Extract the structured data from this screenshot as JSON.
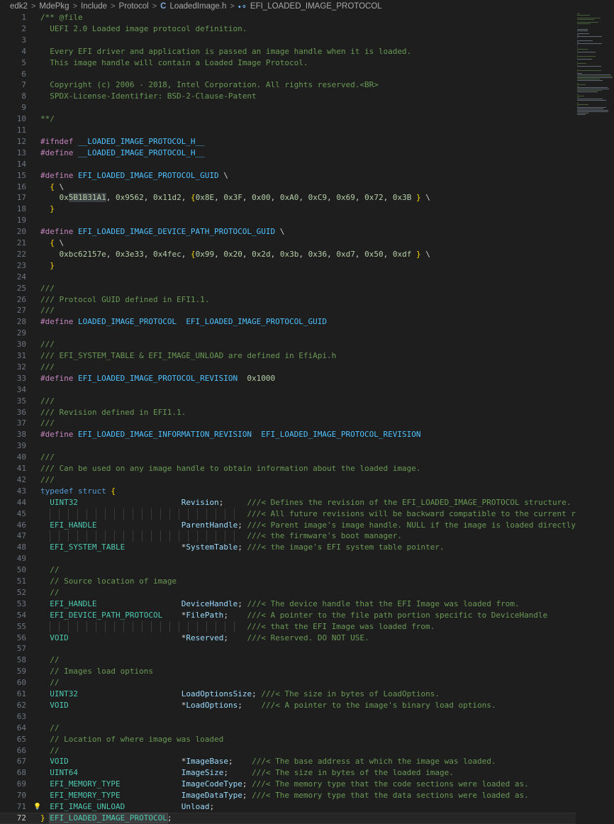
{
  "breadcrumb": {
    "items": [
      "edk2",
      "MdePkg",
      "Include",
      "Protocol"
    ],
    "file_name": "LoadedImage.h",
    "symbol": "EFI_LOADED_IMAGE_PROTOCOL",
    "separator": ">"
  },
  "editor": {
    "current_line": 72,
    "lines": [
      {
        "n": "1",
        "t": "/** @file"
      },
      {
        "n": "2",
        "t": "  UEFI 2.0 Loaded image protocol definition."
      },
      {
        "n": "3",
        "t": ""
      },
      {
        "n": "4",
        "t": "  Every EFI driver and application is passed an image handle when it is loaded."
      },
      {
        "n": "5",
        "t": "  This image handle will contain a Loaded Image Protocol."
      },
      {
        "n": "6",
        "t": ""
      },
      {
        "n": "7",
        "t": "  Copyright (c) 2006 - 2018, Intel Corporation. All rights reserved.<BR>"
      },
      {
        "n": "8",
        "t": "  SPDX-License-Identifier: BSD-2-Clause-Patent"
      },
      {
        "n": "9",
        "t": ""
      },
      {
        "n": "10",
        "t": "**/"
      },
      {
        "n": "11",
        "t": ""
      },
      {
        "n": "12",
        "t": "#ifndef __LOADED_IMAGE_PROTOCOL_H__"
      },
      {
        "n": "13",
        "t": "#define __LOADED_IMAGE_PROTOCOL_H__"
      },
      {
        "n": "14",
        "t": ""
      },
      {
        "n": "15",
        "t": "#define EFI_LOADED_IMAGE_PROTOCOL_GUID \\"
      },
      {
        "n": "16",
        "t": "  { \\"
      },
      {
        "n": "17",
        "t": "    0x5B1B31A1, 0x9562, 0x11d2, {0x8E, 0x3F, 0x00, 0xA0, 0xC9, 0x69, 0x72, 0x3B } \\"
      },
      {
        "n": "18",
        "t": "  }"
      },
      {
        "n": "19",
        "t": ""
      },
      {
        "n": "20",
        "t": "#define EFI_LOADED_IMAGE_DEVICE_PATH_PROTOCOL_GUID \\"
      },
      {
        "n": "21",
        "t": "  { \\"
      },
      {
        "n": "22",
        "t": "    0xbc62157e, 0x3e33, 0x4fec, {0x99, 0x20, 0x2d, 0x3b, 0x36, 0xd7, 0x50, 0xdf } \\"
      },
      {
        "n": "23",
        "t": "  }"
      },
      {
        "n": "24",
        "t": ""
      },
      {
        "n": "25",
        "t": "///"
      },
      {
        "n": "26",
        "t": "/// Protocol GUID defined in EFI1.1."
      },
      {
        "n": "27",
        "t": "///"
      },
      {
        "n": "28",
        "t": "#define LOADED_IMAGE_PROTOCOL  EFI_LOADED_IMAGE_PROTOCOL_GUID"
      },
      {
        "n": "29",
        "t": ""
      },
      {
        "n": "30",
        "t": "///"
      },
      {
        "n": "31",
        "t": "/// EFI_SYSTEM_TABLE & EFI_IMAGE_UNLOAD are defined in EfiApi.h"
      },
      {
        "n": "32",
        "t": "///"
      },
      {
        "n": "33",
        "t": "#define EFI_LOADED_IMAGE_PROTOCOL_REVISION  0x1000"
      },
      {
        "n": "34",
        "t": ""
      },
      {
        "n": "35",
        "t": "///"
      },
      {
        "n": "36",
        "t": "/// Revision defined in EFI1.1."
      },
      {
        "n": "37",
        "t": "///"
      },
      {
        "n": "38",
        "t": "#define EFI_LOADED_IMAGE_INFORMATION_REVISION  EFI_LOADED_IMAGE_PROTOCOL_REVISION"
      },
      {
        "n": "39",
        "t": ""
      },
      {
        "n": "40",
        "t": "///"
      },
      {
        "n": "41",
        "t": "/// Can be used on any image handle to obtain information about the loaded image."
      },
      {
        "n": "42",
        "t": "///"
      },
      {
        "n": "43",
        "t": "typedef struct {"
      },
      {
        "n": "44",
        "t": "  UINT32                      Revision;     ///< Defines the revision of the EFI_LOADED_IMAGE_PROTOCOL structure."
      },
      {
        "n": "45",
        "t": "                                            ///< All future revisions will be backward compatible to the current revis"
      },
      {
        "n": "46",
        "t": "  EFI_HANDLE                  ParentHandle; ///< Parent image's image handle. NULL if the image is loaded directly fro"
      },
      {
        "n": "47",
        "t": "                                            ///< the firmware's boot manager."
      },
      {
        "n": "48",
        "t": "  EFI_SYSTEM_TABLE            *SystemTable; ///< the image's EFI system table pointer."
      },
      {
        "n": "49",
        "t": ""
      },
      {
        "n": "50",
        "t": "  //"
      },
      {
        "n": "51",
        "t": "  // Source location of image"
      },
      {
        "n": "52",
        "t": "  //"
      },
      {
        "n": "53",
        "t": "  EFI_HANDLE                  DeviceHandle; ///< The device handle that the EFI Image was loaded from."
      },
      {
        "n": "54",
        "t": "  EFI_DEVICE_PATH_PROTOCOL    *FilePath;    ///< A pointer to the file path portion specific to DeviceHandle"
      },
      {
        "n": "55",
        "t": "                                            ///< that the EFI Image was loaded from."
      },
      {
        "n": "56",
        "t": "  VOID                        *Reserved;    ///< Reserved. DO NOT USE."
      },
      {
        "n": "57",
        "t": ""
      },
      {
        "n": "58",
        "t": "  //"
      },
      {
        "n": "59",
        "t": "  // Images load options"
      },
      {
        "n": "60",
        "t": "  //"
      },
      {
        "n": "61",
        "t": "  UINT32                      LoadOptionsSize; ///< The size in bytes of LoadOptions."
      },
      {
        "n": "62",
        "t": "  VOID                        *LoadOptions;    ///< A pointer to the image's binary load options."
      },
      {
        "n": "63",
        "t": ""
      },
      {
        "n": "64",
        "t": "  //"
      },
      {
        "n": "65",
        "t": "  // Location of where image was loaded"
      },
      {
        "n": "66",
        "t": "  //"
      },
      {
        "n": "67",
        "t": "  VOID                        *ImageBase;    ///< The base address at which the image was loaded."
      },
      {
        "n": "68",
        "t": "  UINT64                      ImageSize;     ///< The size in bytes of the loaded image."
      },
      {
        "n": "69",
        "t": "  EFI_MEMORY_TYPE             ImageCodeType; ///< The memory type that the code sections were loaded as."
      },
      {
        "n": "70",
        "t": "  EFI_MEMORY_TYPE             ImageDataType; ///< The memory type that the data sections were loaded as."
      },
      {
        "n": "71",
        "t": "  EFI_IMAGE_UNLOAD            Unload;"
      },
      {
        "n": "72",
        "t": "} EFI_LOADED_IMAGE_PROTOCOL;"
      }
    ]
  }
}
